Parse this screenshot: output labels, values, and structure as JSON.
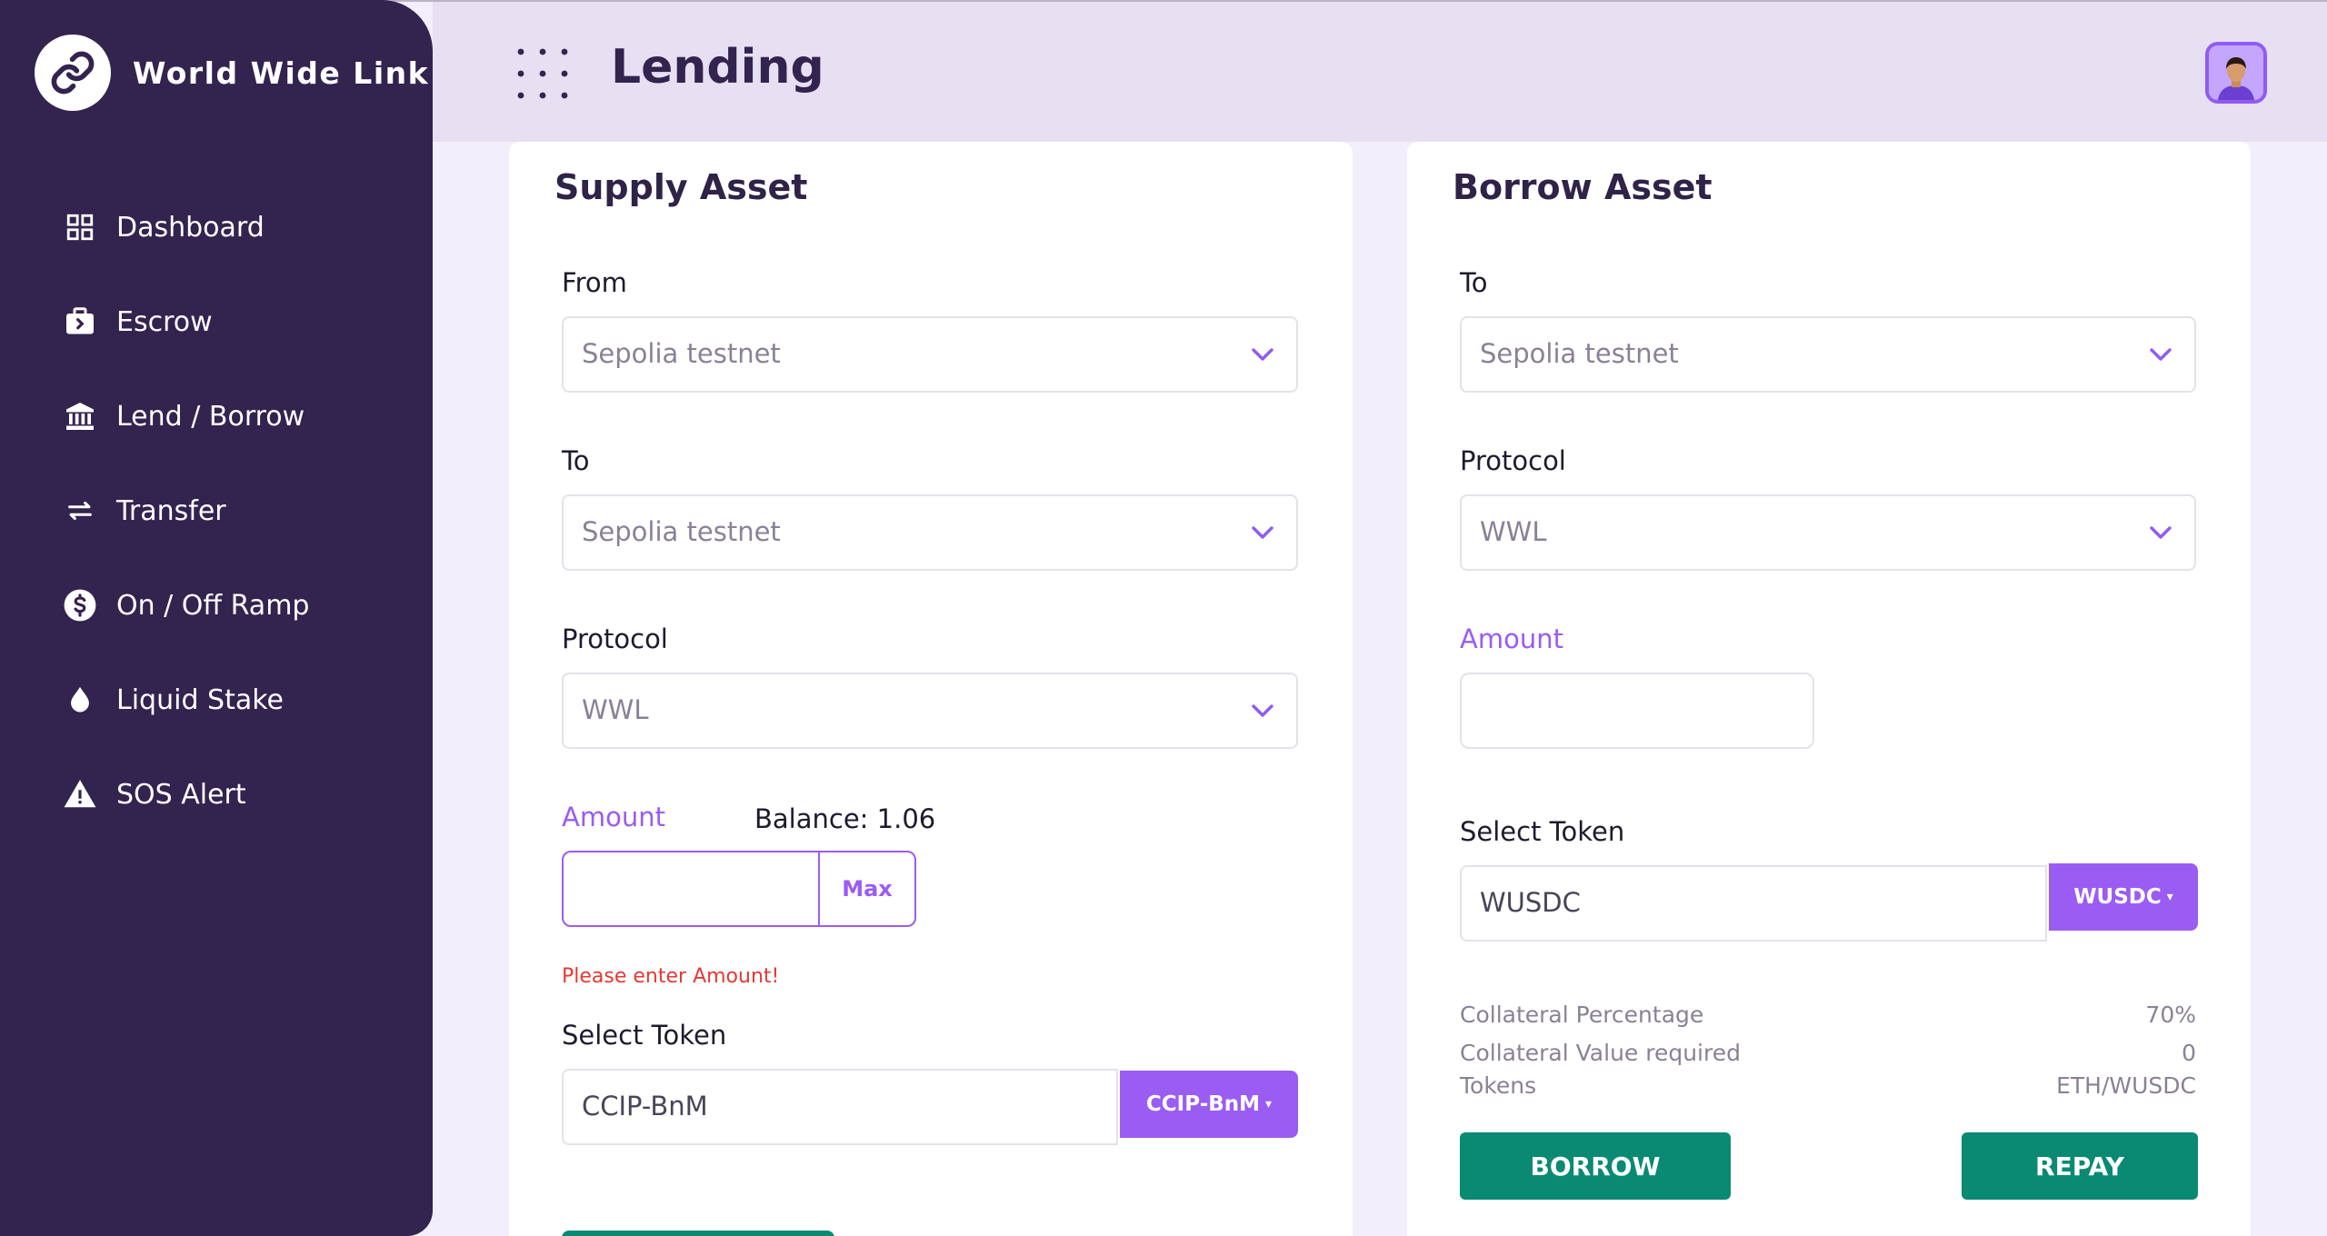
{
  "app": {
    "name": "World Wide Link"
  },
  "sidebar": {
    "items": [
      {
        "label": "Dashboard",
        "icon": "grid-icon"
      },
      {
        "label": "Escrow",
        "icon": "briefcase-icon"
      },
      {
        "label": "Lend / Borrow",
        "icon": "bank-icon"
      },
      {
        "label": "Transfer",
        "icon": "swap-arrows-icon"
      },
      {
        "label": "On / Off Ramp",
        "icon": "dollar-circle-icon"
      },
      {
        "label": "Liquid Stake",
        "icon": "droplet-icon"
      },
      {
        "label": "SOS Alert",
        "icon": "warning-icon"
      }
    ]
  },
  "header": {
    "title": "Lending"
  },
  "supply": {
    "title": "Supply Asset",
    "from_label": "From",
    "from_value": "Sepolia testnet",
    "to_label": "To",
    "to_value": "Sepolia testnet",
    "protocol_label": "Protocol",
    "protocol_value": "WWL",
    "amount_label": "Amount",
    "balance": "Balance: 1.06",
    "amount_value": "",
    "max_label": "Max",
    "error": "Please enter Amount!",
    "token_label": "Select Token",
    "token_value": "CCIP-BnM",
    "token_button": "CCIP-BnM"
  },
  "borrow": {
    "title": "Borrow Asset",
    "to_label": "To",
    "to_value": "Sepolia testnet",
    "protocol_label": "Protocol",
    "protocol_value": "WWL",
    "amount_label": "Amount",
    "amount_value": "",
    "token_label": "Select Token",
    "token_value": "WUSDC",
    "token_button": "WUSDC",
    "info": [
      {
        "label": "Collateral Percentage",
        "value": "70%"
      },
      {
        "label": "Collateral Value required",
        "value": "0"
      },
      {
        "label": "Tokens",
        "value": "ETH/WUSDC"
      }
    ],
    "borrow_button": "BORROW",
    "repay_button": "REPAY"
  },
  "colors": {
    "sidebar": "#33234f",
    "accent": "#9b5cf3",
    "action": "#0a8a72",
    "error": "#e53935"
  }
}
